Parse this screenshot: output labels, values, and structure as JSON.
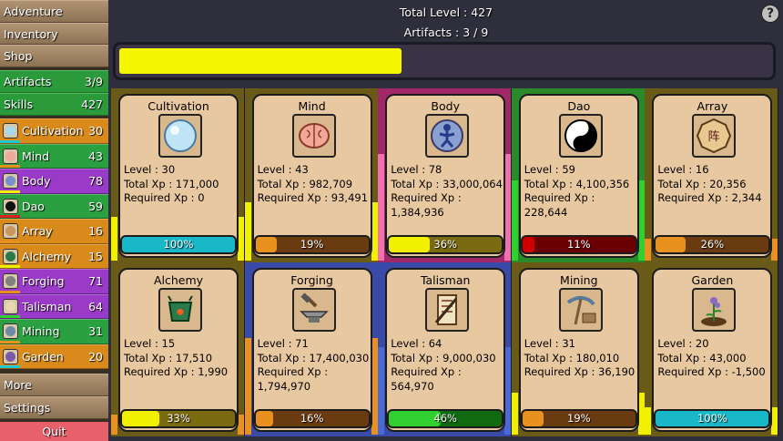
{
  "header": {
    "total_level": "Total Level : 427",
    "artifacts": "Artifacts : 3 / 9",
    "help": "?"
  },
  "top_progress": {
    "fraction": 0.43,
    "color": "#f6f600"
  },
  "sidebar": {
    "nav_top": [
      {
        "label": "Adventure",
        "name": "sidebar-adventure"
      },
      {
        "label": "Inventory",
        "name": "sidebar-inventory"
      },
      {
        "label": "Shop",
        "name": "sidebar-shop"
      }
    ],
    "artifacts": {
      "label": "Artifacts",
      "value": "3/9"
    },
    "skills": {
      "label": "Skills",
      "value": "427"
    },
    "skill_items": [
      {
        "label": "Cultivation",
        "value": "30",
        "bg": "#d98a1a",
        "icon": "orb-icon",
        "icon_color": "#a8d8f0",
        "ul": "#20c8d0"
      },
      {
        "label": "Mind",
        "value": "43",
        "bg": "#2aa040",
        "icon": "brain-icon",
        "icon_color": "#f0a898",
        "ul": "#e89020"
      },
      {
        "label": "Body",
        "value": "78",
        "bg": "#9a3ac8",
        "icon": "figure-icon",
        "icon_color": "#7890c8",
        "ul": "#f0f000"
      },
      {
        "label": "Dao",
        "value": "59",
        "bg": "#2aa040",
        "icon": "yin-yang-icon",
        "icon_color": "#111111",
        "ul": "#e02020"
      },
      {
        "label": "Array",
        "value": "16",
        "bg": "#d98a1a",
        "icon": "bagua-icon",
        "icon_color": "#c89860",
        "ul": "#e89020"
      },
      {
        "label": "Alchemy",
        "value": "15",
        "bg": "#d98a1a",
        "icon": "cauldron-icon",
        "icon_color": "#2a7a4a",
        "ul": "#f0f000"
      },
      {
        "label": "Forging",
        "value": "71",
        "bg": "#9a3ac8",
        "icon": "anvil-icon",
        "icon_color": "#808080",
        "ul": "#e89020"
      },
      {
        "label": "Talisman",
        "value": "64",
        "bg": "#9a3ac8",
        "icon": "scroll-icon",
        "icon_color": "#e8d8b0",
        "ul": "#30d030"
      },
      {
        "label": "Mining",
        "value": "31",
        "bg": "#2aa040",
        "icon": "pickaxe-icon",
        "icon_color": "#6a8aa8",
        "ul": "#e89020"
      },
      {
        "label": "Garden",
        "value": "20",
        "bg": "#d98a1a",
        "icon": "plant-icon",
        "icon_color": "#7a5aa8",
        "ul": "#20c8d0"
      }
    ],
    "nav_bottom": [
      {
        "label": "More",
        "name": "sidebar-more"
      },
      {
        "label": "Settings",
        "name": "sidebar-settings"
      }
    ],
    "quit": "Quit"
  },
  "cards": [
    {
      "title": "Cultivation",
      "level": "Level : 30",
      "total": "Total Xp : 171,000",
      "req": "Required Xp : 0",
      "pct": "100%",
      "frac": 1.0,
      "fill": "#18b8c8",
      "track": "#106870",
      "col_bg": "#6a5a18",
      "edge": "#f0f000",
      "edge_h": 0.32,
      "icon": "orb-icon"
    },
    {
      "title": "Mind",
      "level": "Level : 43",
      "total": "Total Xp : 982,709",
      "req": "Required Xp : 93,491",
      "pct": "19%",
      "frac": 0.19,
      "fill": "#e89020",
      "track": "#6a3a10",
      "col_bg": "#6a5a18",
      "edge": "#f0f000",
      "edge_h": 0.43,
      "icon": "brain-icon"
    },
    {
      "title": "Body",
      "level": "Level : 78",
      "total": "Total Xp : 33,000,064",
      "req_line1": "Required Xp :",
      "req_line2": "1,384,936",
      "pct": "36%",
      "frac": 0.36,
      "fill": "#f0f000",
      "track": "#7a6a10",
      "col_bg": "#a02868",
      "edge": "#f070b0",
      "edge_h": 0.78,
      "icon": "figure-icon"
    },
    {
      "title": "Dao",
      "level": "Level : 59",
      "total": "Total Xp : 4,100,356",
      "req": "Required Xp : 228,644",
      "pct": "11%",
      "frac": 0.11,
      "fill": "#d00000",
      "track": "#6a0000",
      "col_bg": "#2a8a2a",
      "edge": "#30d030",
      "edge_h": 0.59,
      "icon": "yin-yang-icon"
    },
    {
      "title": "Array",
      "level": "Level : 16",
      "total": "Total Xp : 20,356",
      "req": "Required Xp : 2,344",
      "pct": "26%",
      "frac": 0.26,
      "fill": "#e89020",
      "track": "#6a3a10",
      "col_bg": "#6a5a18",
      "edge": "#e89020",
      "edge_h": 0.16,
      "icon": "bagua-icon"
    },
    {
      "title": "Alchemy",
      "level": "Level : 15",
      "total": "Total Xp : 17,510",
      "req": "Required Xp : 1,990",
      "pct": "33%",
      "frac": 0.33,
      "fill": "#f0f000",
      "track": "#7a6a10",
      "col_bg": "#6a5a18",
      "edge": "#e89020",
      "edge_h": 0.15,
      "icon": "cauldron-icon"
    },
    {
      "title": "Forging",
      "level": "Level : 71",
      "total": "Total Xp : 17,400,030",
      "req_line1": "Required Xp :",
      "req_line2": "1,794,970",
      "pct": "16%",
      "frac": 0.16,
      "fill": "#e89020",
      "track": "#6a3a10",
      "col_bg": "#3a4aa8",
      "edge": "#e89020",
      "edge_h": 0.71,
      "icon": "anvil-icon"
    },
    {
      "title": "Talisman",
      "level": "Level : 64",
      "total": "Total Xp : 9,000,030",
      "req": "Required Xp : 564,970",
      "pct": "46%",
      "frac": 0.46,
      "fill": "#30d030",
      "track": "#106a10",
      "col_bg": "#3a4aa8",
      "edge": "#4a6ad8",
      "edge_h": 0.64,
      "icon": "scroll-icon"
    },
    {
      "title": "Mining",
      "level": "Level : 31",
      "total": "Total Xp : 180,010",
      "req": "Required Xp : 36,190",
      "pct": "19%",
      "frac": 0.19,
      "fill": "#e89020",
      "track": "#6a3a10",
      "col_bg": "#6a5a18",
      "edge": "#f0f000",
      "edge_h": 0.31,
      "icon": "pickaxe-icon"
    },
    {
      "title": "Garden",
      "level": "Level : 20",
      "total": "Total Xp : 43,000",
      "req": "Required Xp : -1,500",
      "pct": "100%",
      "frac": 1.0,
      "fill": "#18b8c8",
      "track": "#106870",
      "col_bg": "#6a5a18",
      "edge": "#f0f000",
      "edge_h": 0.2,
      "icon": "plant-icon"
    }
  ]
}
